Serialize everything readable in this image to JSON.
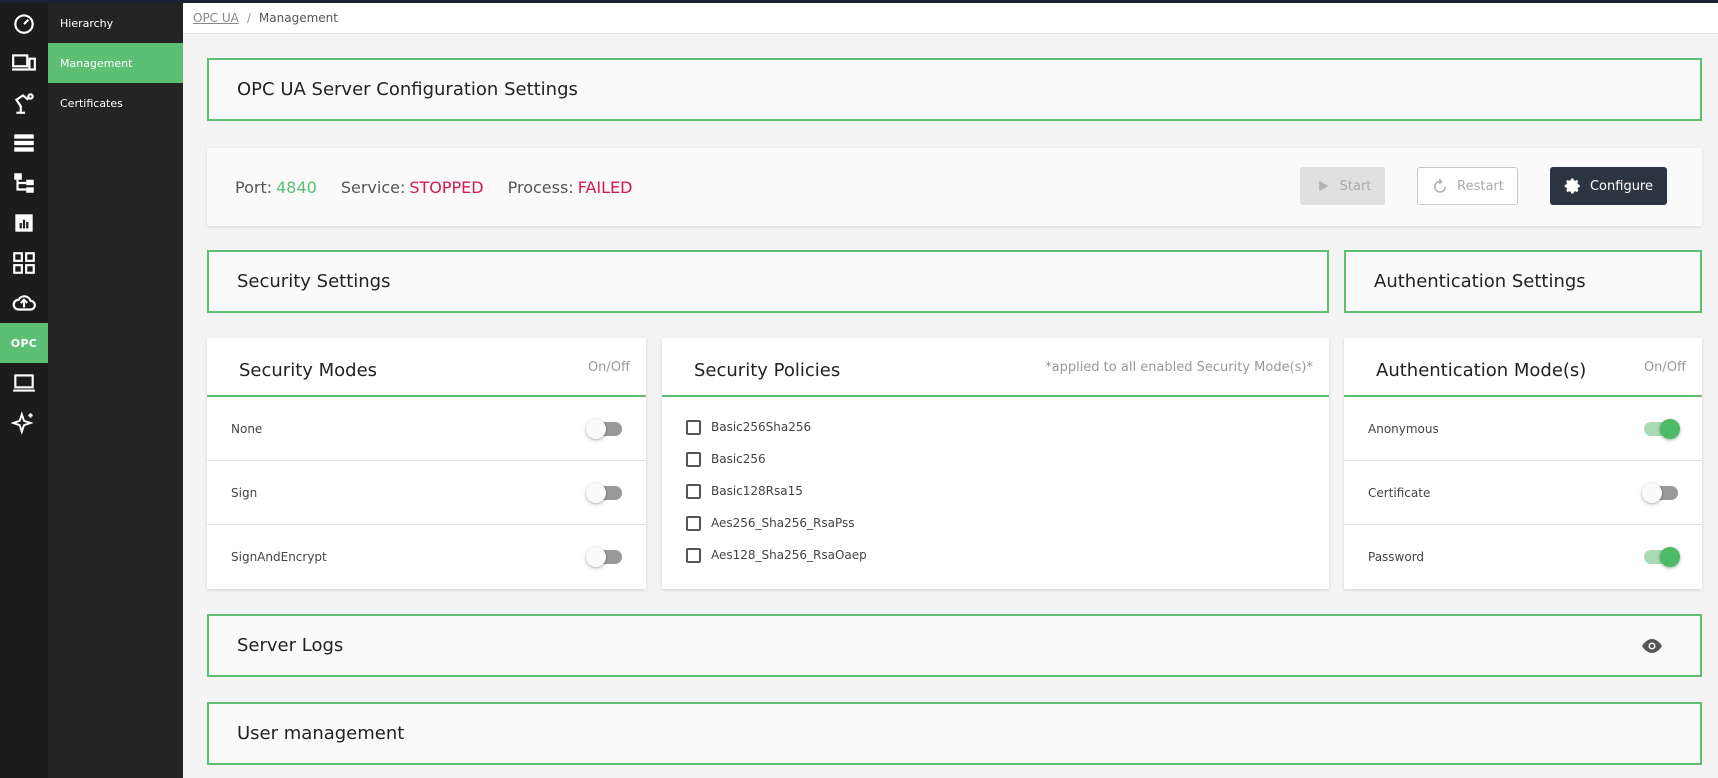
{
  "sidebar": {
    "rail": [
      {
        "icon": "dashboard-gauge-icon"
      },
      {
        "icon": "devices-icon"
      },
      {
        "icon": "robot-arm-icon"
      },
      {
        "icon": "storage-list-icon"
      },
      {
        "icon": "hierarchy-tree-icon"
      },
      {
        "icon": "report-chart-icon"
      },
      {
        "icon": "apps-grid-icon"
      },
      {
        "icon": "cloud-upload-icon"
      },
      {
        "label": "OPC",
        "active": true
      },
      {
        "icon": "laptop-icon"
      },
      {
        "icon": "sparkle-icon"
      }
    ],
    "subnav": [
      {
        "label": "Hierarchy"
      },
      {
        "label": "Management",
        "active": true
      },
      {
        "label": "Certificates"
      }
    ]
  },
  "breadcrumb": {
    "parent": "OPC UA",
    "separator": "/",
    "current": "Management"
  },
  "page": {
    "title": "OPC UA Server Configuration Settings"
  },
  "status": {
    "port_label": "Port:",
    "port_value": "4840",
    "service_label": "Service:",
    "service_value": "STOPPED",
    "process_label": "Process:",
    "process_value": "FAILED"
  },
  "buttons": {
    "start": "Start",
    "restart": "Restart",
    "configure": "Configure"
  },
  "sections": {
    "security": "Security Settings",
    "authentication": "Authentication Settings",
    "server_logs": "Server Logs",
    "user_management": "User management"
  },
  "security_modes": {
    "title": "Security Modes",
    "note": "On/Off",
    "items": [
      {
        "label": "None",
        "enabled": false
      },
      {
        "label": "Sign",
        "enabled": false
      },
      {
        "label": "SignAndEncrypt",
        "enabled": false
      }
    ]
  },
  "security_policies": {
    "title": "Security Policies",
    "note": "*applied to all enabled Security Mode(s)*",
    "items": [
      {
        "label": "Basic256Sha256",
        "checked": false
      },
      {
        "label": "Basic256",
        "checked": false
      },
      {
        "label": "Basic128Rsa15",
        "checked": false
      },
      {
        "label": "Aes256_Sha256_RsaPss",
        "checked": false
      },
      {
        "label": "Aes128_Sha256_RsaOaep",
        "checked": false
      }
    ]
  },
  "auth_modes": {
    "title": "Authentication Mode(s)",
    "note": "On/Off",
    "items": [
      {
        "label": "Anonymous",
        "enabled": true
      },
      {
        "label": "Certificate",
        "enabled": false
      },
      {
        "label": "Password",
        "enabled": true
      }
    ]
  },
  "colors": {
    "accent": "#5cbf73",
    "danger": "#d5184f",
    "dark_button": "#2c3642"
  }
}
